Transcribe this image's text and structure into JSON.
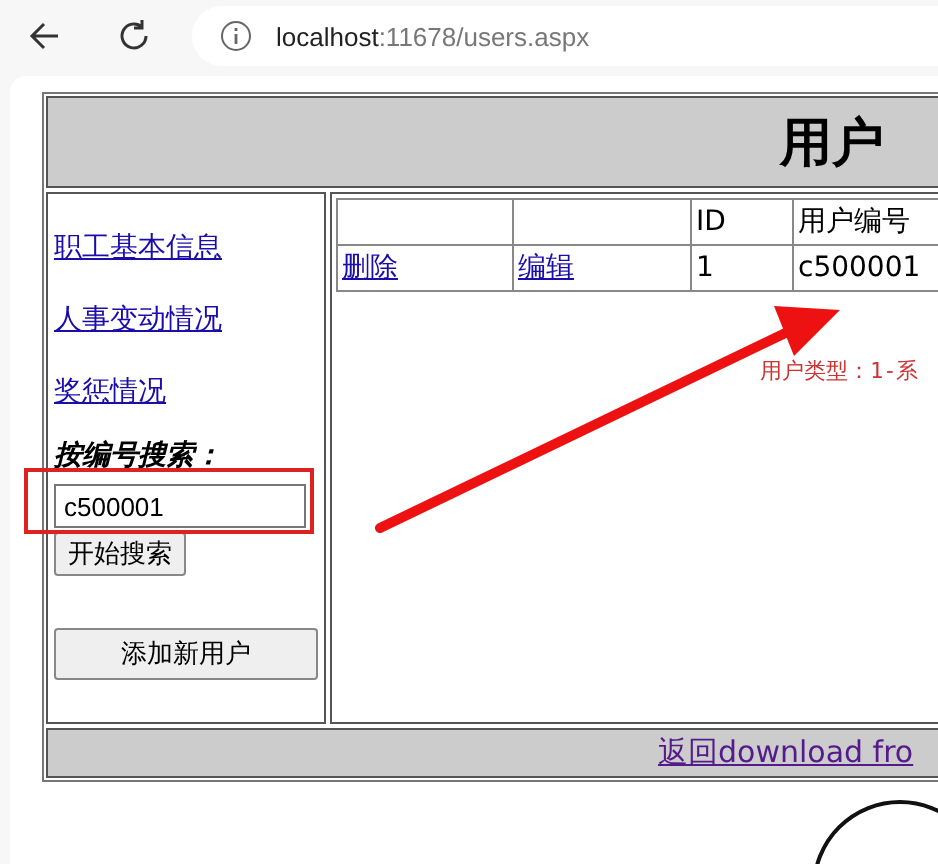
{
  "browser": {
    "url_host": "localhost",
    "url_rest": ":11678/users.aspx"
  },
  "header": {
    "title": "用户"
  },
  "sidebar": {
    "links": [
      "职工基本信息",
      "人事变动情况",
      "奖惩情况"
    ],
    "search_label": "按编号搜索：",
    "search_value": "c500001",
    "search_button": "开始搜索",
    "add_button": "添加新用户"
  },
  "table": {
    "columns": [
      "",
      "",
      "ID",
      "用户编号"
    ],
    "rows": [
      [
        "删除",
        "编辑",
        "1",
        "c500001"
      ]
    ]
  },
  "note": "用户类型：1-系",
  "footer": {
    "link": "返回download fro"
  }
}
